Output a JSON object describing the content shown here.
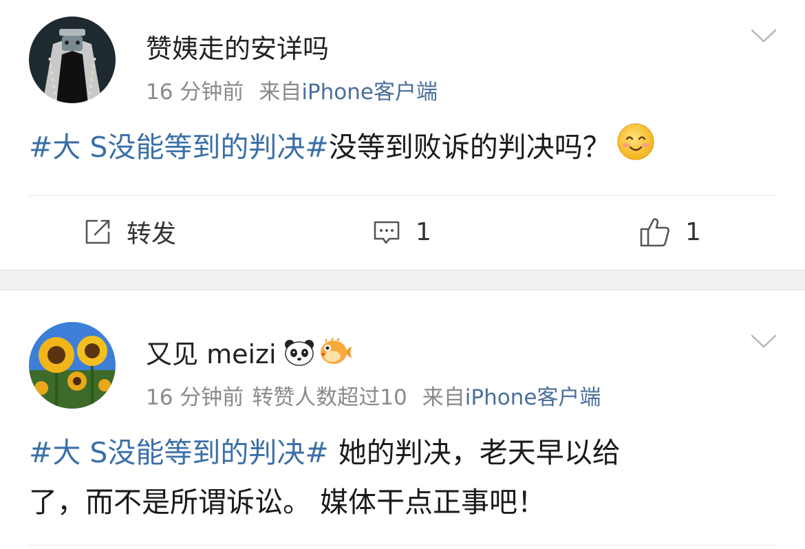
{
  "posts": [
    {
      "username": "赞姨走的安详吗",
      "time": "16 分钟前",
      "source_prefix": "来自",
      "source": "iPhone客户端",
      "topic": "#大 S没能等到的判决#",
      "text": "没等到败诉的判决吗？",
      "actions": {
        "repost_label": "转发",
        "comment_count": "1",
        "like_count": "1"
      },
      "icons": {
        "avatar": "dark-cloak-avatar",
        "menu": "chevron-down-icon",
        "emoji": "smile-emoji-icon",
        "repost": "edit-share-icon",
        "comment": "comment-icon",
        "like": "thumbs-up-icon"
      }
    },
    {
      "username": "又见 meizi",
      "time": "16 分钟前",
      "extra": "转赞人数超过10",
      "source_prefix": "来自",
      "source": "iPhone客户端",
      "topic": "#大 S没能等到的判决#",
      "text_line1": "她的判决，老天早以给",
      "text_line2": "了，而不是所谓诉讼。 媒体干点正事吧！",
      "icons": {
        "avatar": "sunflower-avatar",
        "badge1": "panda-badge-icon",
        "badge2": "pufferfish-badge-icon",
        "menu": "chevron-down-icon"
      }
    }
  ],
  "colors": {
    "topic": "#3a6fa8",
    "meta_gray": "#8a8a8a",
    "source_blue": "#4a6e9a",
    "separator_band": "#f1f1f1"
  }
}
